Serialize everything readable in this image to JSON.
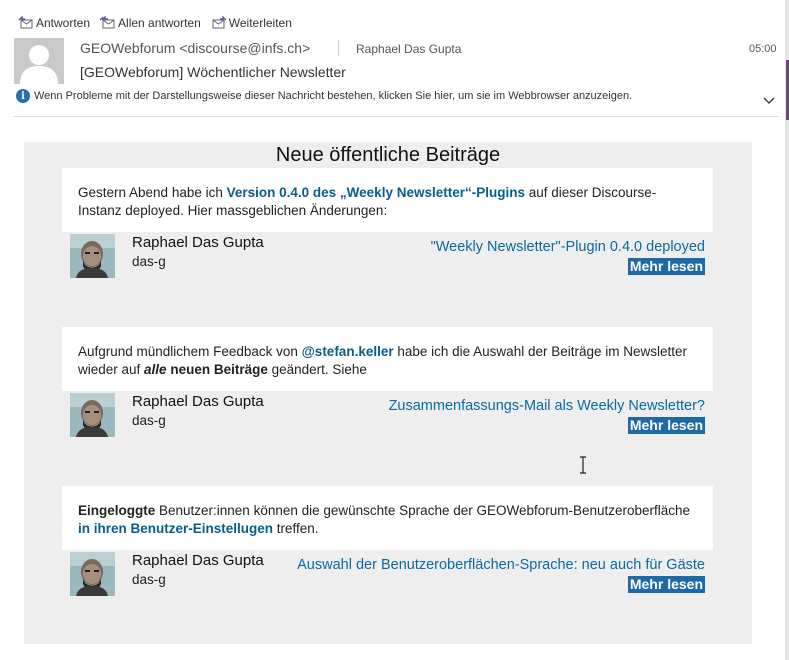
{
  "toolbar": {
    "reply": "Antworten",
    "reply_all": "Allen antworten",
    "forward": "Weiterleiten"
  },
  "header": {
    "sender": "GEOWebforum <discourse@infs.ch>",
    "recipient": "Raphael Das Gupta",
    "time": "05:00",
    "subject": "[GEOWebforum] Wöchentlicher Newsletter",
    "info_text": "Wenn Probleme mit der Darstellungsweise dieser Nachricht bestehen, klicken Sie hier, um sie im Webbrowser anzuzeigen."
  },
  "newsletter": {
    "title": "Neue öffentliche Beiträge",
    "posts": [
      {
        "text_parts": {
          "a": "Gestern Abend habe ich ",
          "link": "Version 0.4.0 des „Weekly Newsletter“-Plugins",
          "b": " auf dieser Discourse-Instanz deployed. Hier massgeblichen Änderungen:"
        },
        "author": "Raphael Das Gupta",
        "handle": "das-g",
        "title": "\"Weekly Newsletter\"-Plugin 0.4.0 deployed",
        "more": "Mehr lesen"
      },
      {
        "text_parts": {
          "a": "Aufgrund mündlichem Feedback von ",
          "mention": "@stefan.keller",
          "b": " habe ich die Auswahl der Beiträge im Newsletter wieder auf ",
          "em": "alle",
          "strong": " neuen Beiträge",
          "c": " geändert. Siehe"
        },
        "author": "Raphael Das Gupta",
        "handle": "das-g",
        "title": "Zusammenfassungs-Mail als Weekly Newsletter?",
        "more": "Mehr lesen"
      },
      {
        "text_parts": {
          "strong": "Eingeloggte",
          "a": " Benutzer:innen können die gewünschte Sprache der GEOWebforum-Benutzeroberfläche ",
          "link": "in ihren Benutzer-Einstellugen",
          "b": " treffen."
        },
        "author": "Raphael Das Gupta",
        "handle": "das-g",
        "title": "Auswahl der Benutzeroberflächen-Sprache: neu auch für Gäste",
        "more": "Mehr lesen"
      }
    ]
  },
  "colors": {
    "link": "#0a5c8c",
    "button": "#1e6aa8",
    "panel": "#eeeeee"
  },
  "icons": [
    "reply-icon",
    "reply-all-icon",
    "forward-icon",
    "info-icon",
    "chevron-down-icon",
    "default-avatar-icon",
    "text-cursor-icon"
  ]
}
